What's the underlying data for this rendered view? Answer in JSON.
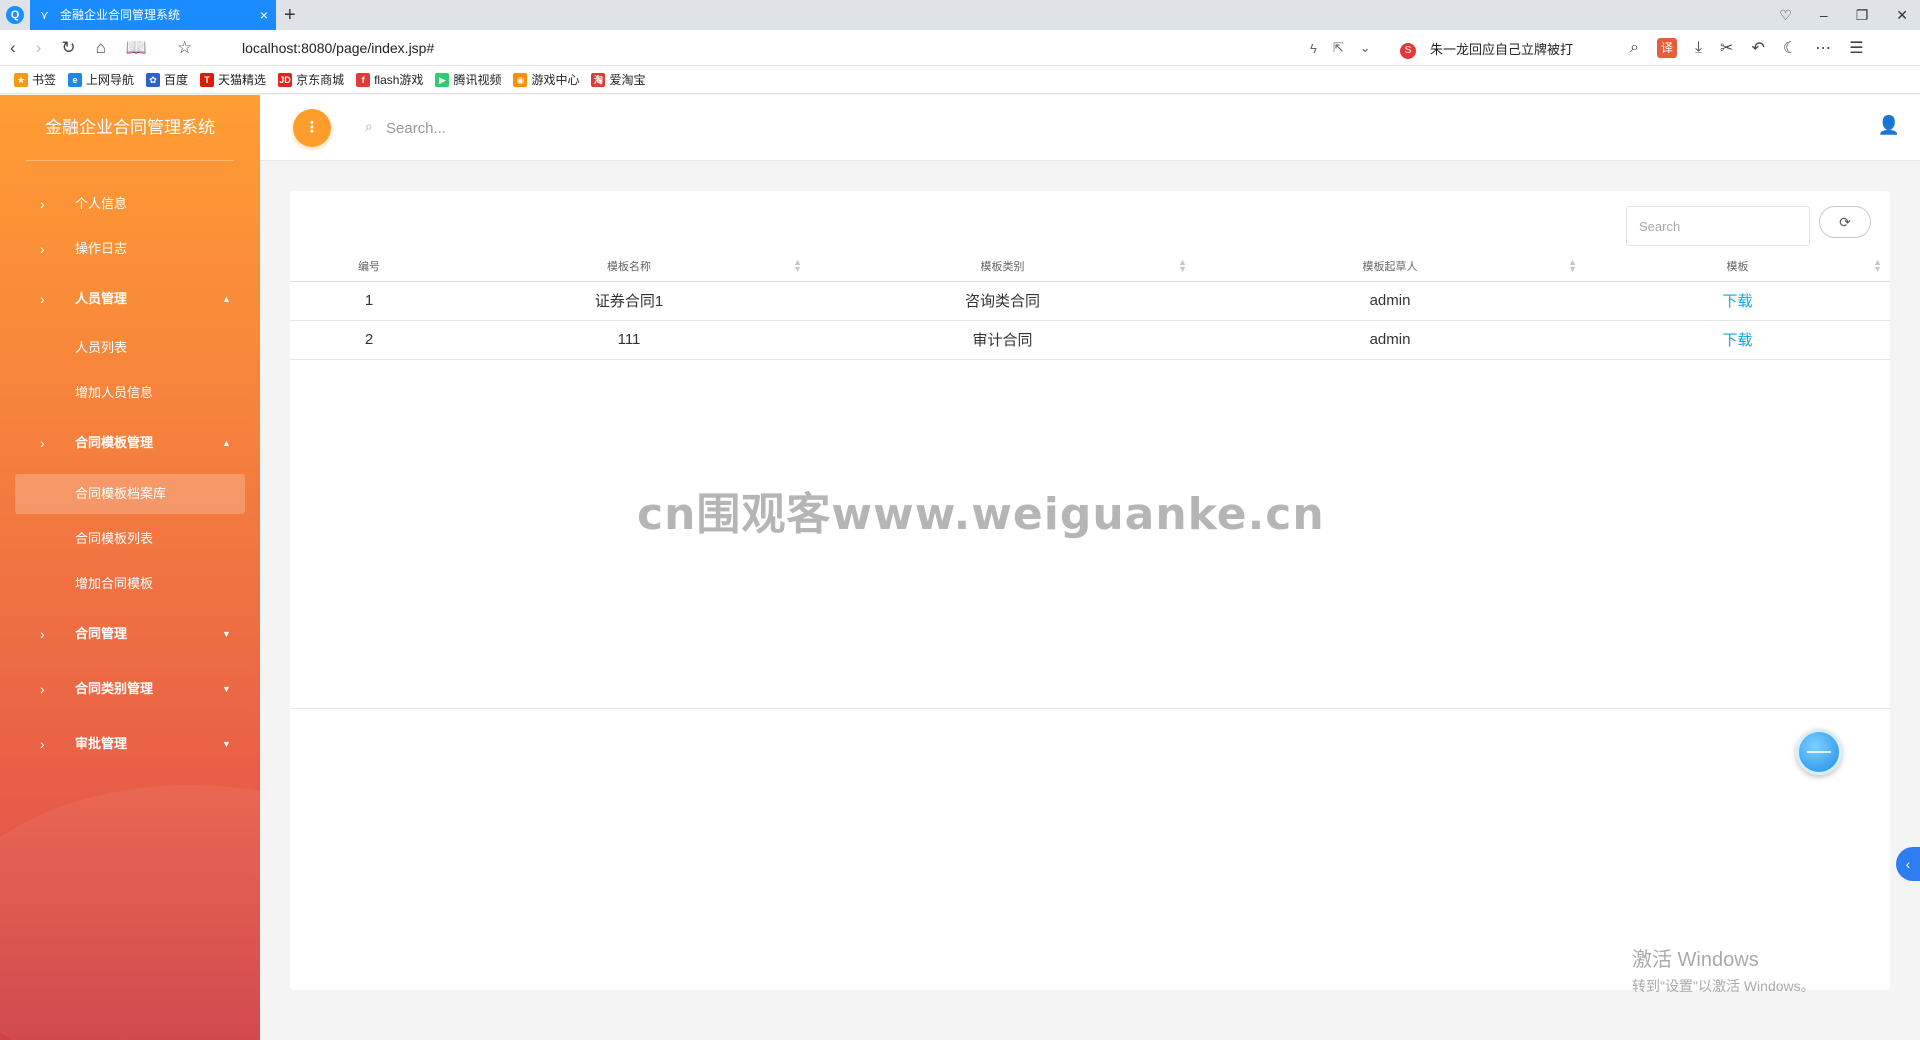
{
  "browser": {
    "tab_title": "金融企业合同管理系统",
    "url": "localhost:8080/page/index.jsp#",
    "news_ticker": "朱一龙回应自己立牌被打",
    "bookmarks": [
      {
        "label": "书签",
        "color": "#f39c12"
      },
      {
        "label": "上网导航",
        "color": "#1e88e5"
      },
      {
        "label": "百度",
        "color": "#2d62ce"
      },
      {
        "label": "天猫精选",
        "color": "#d81e06"
      },
      {
        "label": "京东商城",
        "color": "#e1251b"
      },
      {
        "label": "flash游戏",
        "color": "#e53935"
      },
      {
        "label": "腾讯视频",
        "color": "#2ecc71"
      },
      {
        "label": "游戏中心",
        "color": "#ff8f00"
      },
      {
        "label": "爱淘宝",
        "color": "#e53935"
      }
    ]
  },
  "sidebar": {
    "brand": "金融企业合同管理系统",
    "items": [
      {
        "label": "个人信息"
      },
      {
        "label": "操作日志"
      },
      {
        "label": "人员管理"
      },
      {
        "label": "人员列表"
      },
      {
        "label": "增加人员信息"
      },
      {
        "label": "合同模板管理"
      },
      {
        "label": "合同模板档案库"
      },
      {
        "label": "合同模板列表"
      },
      {
        "label": "增加合同模板"
      },
      {
        "label": "合同管理"
      },
      {
        "label": "合同类别管理"
      },
      {
        "label": "审批管理"
      }
    ]
  },
  "navbar": {
    "search_placeholder": "Search..."
  },
  "table": {
    "search_placeholder": "Search",
    "headers": [
      "编号",
      "模板名称",
      "模板类别",
      "模板起草人",
      "模板"
    ],
    "rows": [
      [
        "1",
        "证券合同1",
        "咨询类合同",
        "admin",
        "下载"
      ],
      [
        "2",
        "111",
        "审计合同",
        "admin",
        "下载"
      ]
    ]
  },
  "overlay": {
    "watermark": "cn围观客www.weiguanke.cn",
    "activate_title": "激活 Windows",
    "activate_sub": "转到\"设置\"以激活 Windows。"
  },
  "colors": {
    "accent": "#ff9d2a",
    "tab_blue": "#1a8cff",
    "link": "#18a6d9"
  }
}
